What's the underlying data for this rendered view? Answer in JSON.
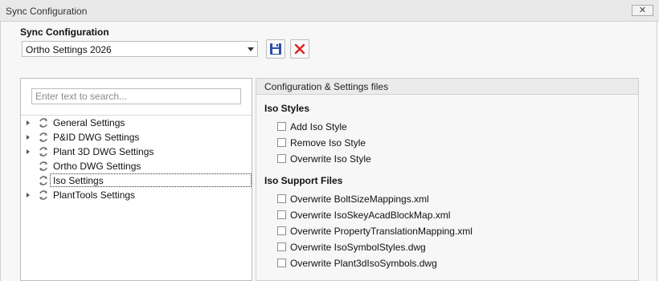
{
  "window": {
    "title": "Sync Configuration",
    "close_symbol": "✕"
  },
  "config": {
    "label": "Sync Configuration",
    "selected": "Ortho Settings 2026"
  },
  "toolbar": {
    "save_icon": "save-icon",
    "delete_icon": "delete-icon",
    "delete_color": "#e02020",
    "save_color": "#2a4fa8"
  },
  "tree": {
    "search_placeholder": "Enter text to search...",
    "items": [
      {
        "label": "General Settings",
        "expandable": true
      },
      {
        "label": "P&ID DWG Settings",
        "expandable": true
      },
      {
        "label": "Plant 3D DWG Settings",
        "expandable": true
      },
      {
        "label": "Ortho DWG Settings",
        "expandable": false
      },
      {
        "label": "Iso Settings",
        "expandable": false,
        "selected": true
      },
      {
        "label": "PlantTools Settings",
        "expandable": true
      }
    ]
  },
  "details": {
    "header": "Configuration & Settings files",
    "groups": [
      {
        "title": "Iso Styles",
        "options": [
          "Add Iso Style",
          "Remove Iso Style",
          "Overwrite Iso Style"
        ]
      },
      {
        "title": "Iso Support Files",
        "options": [
          "Overwrite BoltSizeMappings.xml",
          "Overwrite IsoSkeyAcadBlockMap.xml",
          "Overwrite PropertyTranslationMapping.xml",
          "Overwrite IsoSymbolStyles.dwg",
          "Overwrite Plant3dIsoSymbols.dwg"
        ]
      }
    ]
  }
}
